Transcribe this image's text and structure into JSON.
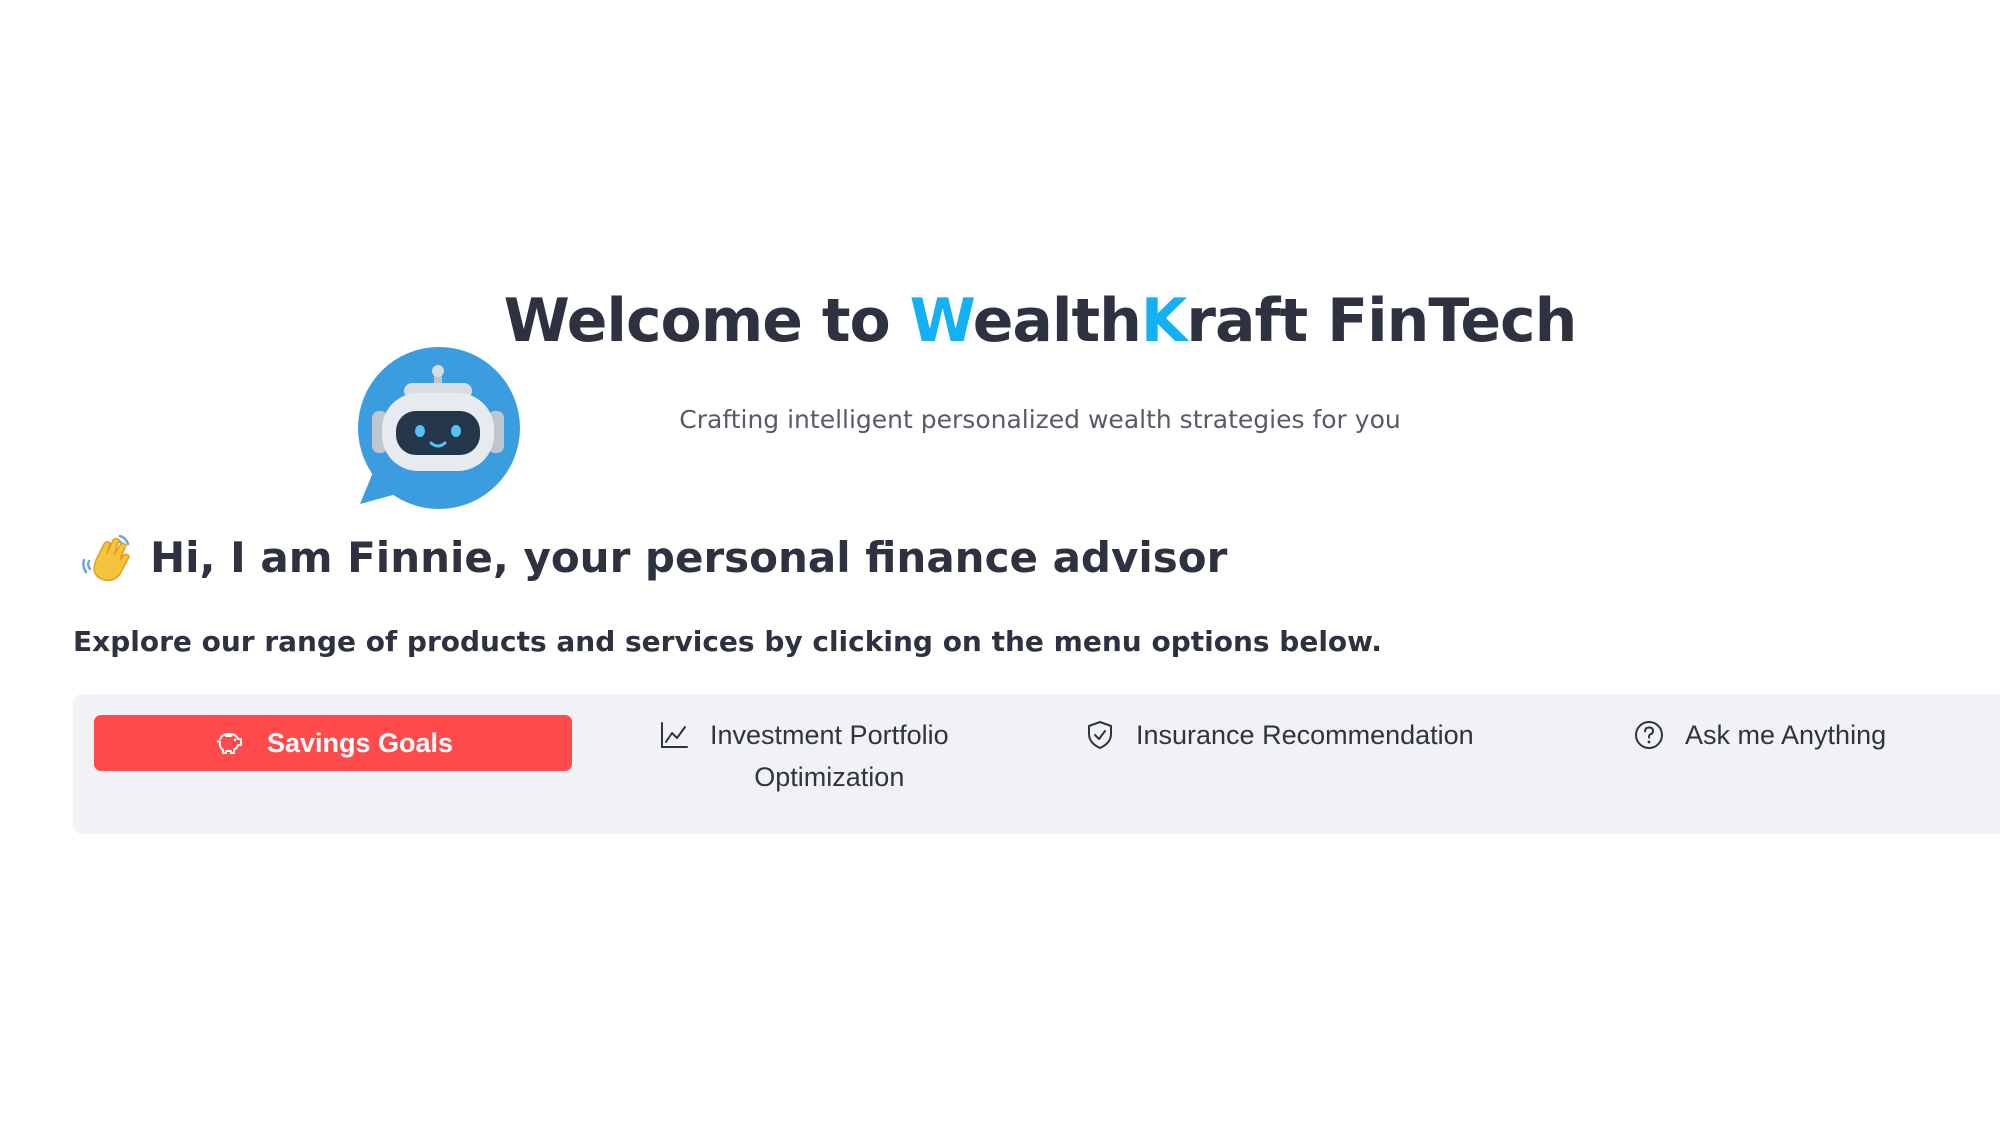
{
  "header": {
    "title_prefix": "Welcome to ",
    "title_accent_1": "W",
    "title_mid": "ealth",
    "title_accent_2": "K",
    "title_suffix": "raft FinTech",
    "subtitle": "Crafting intelligent personalized wealth strategies for you",
    "accent_color": "#14b0f5",
    "text_color": "#2e3140"
  },
  "assistant": {
    "avatar_icon": "robot-chat-bubble-icon",
    "avatar_color": "#3b9de0",
    "greeting_icon": "waving-hand-icon",
    "greeting": "Hi, I am Finnie, your personal finance advisor"
  },
  "intro": {
    "text": "Explore our range of products and services by clicking on the menu options below."
  },
  "menu": {
    "background": "#f0f2f6",
    "active_color": "#ff4b4b",
    "items": [
      {
        "label": "Savings Goals",
        "icon": "piggy-bank-icon",
        "active": true
      },
      {
        "label_line1": "Investment Portfolio",
        "label_line2": "Optimization",
        "icon": "line-chart-icon",
        "active": false
      },
      {
        "label": "Insurance Recommendation",
        "icon": "shield-check-icon",
        "active": false
      },
      {
        "label": "Ask me Anything",
        "icon": "question-circle-icon",
        "active": false
      }
    ]
  }
}
